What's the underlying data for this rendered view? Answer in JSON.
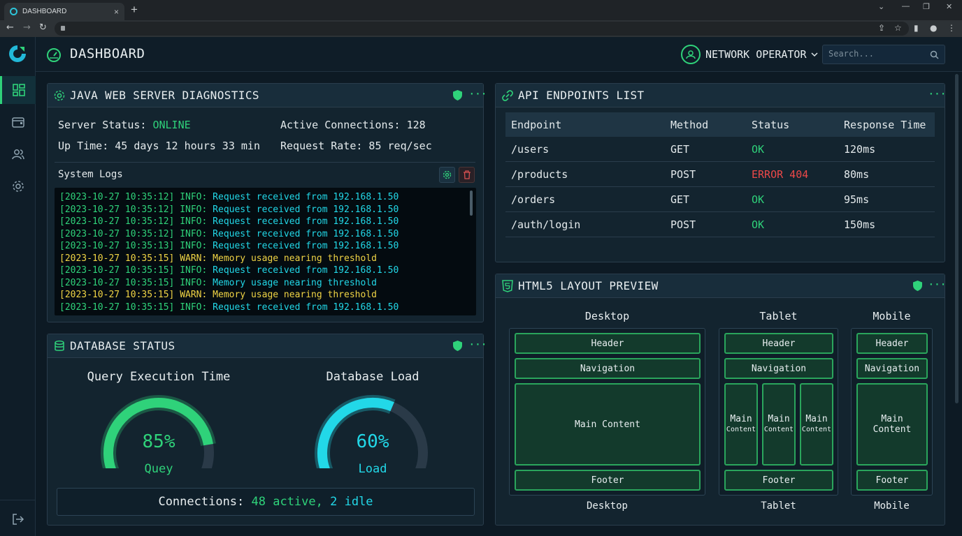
{
  "browser": {
    "tab_title": "DASHBOARD",
    "tab_close": "×",
    "new_tab": "+",
    "minimize": "⌄",
    "restore": "—",
    "maximize": "❐",
    "close": "✕"
  },
  "sidebar": {
    "items": [
      {
        "name": "dashboard",
        "icon": "grid-icon",
        "active": true
      },
      {
        "name": "wallet",
        "icon": "wallet-icon",
        "active": false
      },
      {
        "name": "users",
        "icon": "users-icon",
        "active": false
      },
      {
        "name": "settings",
        "icon": "gear-icon",
        "active": false
      }
    ],
    "logout_icon": "logout-icon"
  },
  "header": {
    "title": "DASHBOARD",
    "user_name": "NETWORK OPERATOR",
    "search_placeholder": "Search..."
  },
  "java_panel": {
    "title": "JAVA WEB SERVER DIAGNOSTICS",
    "server_status_label": "Server Status: ",
    "server_status_value": "ONLINE",
    "uptime": "Up Time: 45 days 12 hours 33 min",
    "active_connections": "Active Connections: 128",
    "request_rate": "Request Rate: 85 req/sec",
    "logs_label": "System Logs",
    "logs": [
      {
        "ts": "[2023-10-27 10:35:12]",
        "level": "INFO:",
        "msg": "Request received from 192.168.1.50",
        "type": "info"
      },
      {
        "ts": "[2023-10-27 10:35:12]",
        "level": "INFO:",
        "msg": "Request received from 192.168.1.50",
        "type": "info"
      },
      {
        "ts": "[2023-10-27 10:35:12]",
        "level": "INFO:",
        "msg": "Request received from 192.168.1.50",
        "type": "info"
      },
      {
        "ts": "[2023-10-27 10:35:12]",
        "level": "INFO:",
        "msg": "Request received from 192.168.1.50",
        "type": "info"
      },
      {
        "ts": "[2023-10-27 10:35:13]",
        "level": "INFO:",
        "msg": "Request received from 192.168.1.50",
        "type": "info"
      },
      {
        "ts": "[2023-10-27 10:35:15]",
        "level": "WARN:",
        "msg": "Memory usage nearing threshold",
        "type": "warn"
      },
      {
        "ts": "[2023-10-27 10:35:15]",
        "level": "INFO:",
        "msg": "Request received from 192.168.1.50",
        "type": "info"
      },
      {
        "ts": "[2023-10-27 10:35:15]",
        "level": "INFO:",
        "msg": "Memory usage nearing threshold",
        "type": "info"
      },
      {
        "ts": "[2023-10-27 10:35:15]",
        "level": "WARN:",
        "msg": "Memory usage nearing threshold",
        "type": "warn"
      },
      {
        "ts": "[2023-10-27 10:35:15]",
        "level": "INFO:",
        "msg": "Request received from 192.168.1.50",
        "type": "info"
      }
    ]
  },
  "db_panel": {
    "title": "DATABASE STATUS",
    "gauges": [
      {
        "label": "Query Execution Time",
        "value": "85%",
        "fraction": 0.85,
        "sub": "Quey",
        "color": "#2fd27a"
      },
      {
        "label": "Database Load",
        "value": "60%",
        "fraction": 0.6,
        "sub": "Load",
        "color": "#22d8e8"
      }
    ],
    "connections_label": "Connections: ",
    "connections_active": "48 active,",
    "connections_idle": "2 idle"
  },
  "api_panel": {
    "title": "API ENDPOINTS LIST",
    "columns": [
      "Endpoint",
      "Method",
      "Status",
      "Response Time"
    ],
    "rows": [
      {
        "endpoint": "/users",
        "method": "GET",
        "status": "OK",
        "ok": true,
        "time": "120ms"
      },
      {
        "endpoint": "/products",
        "method": "POST",
        "status": "ERROR 404",
        "ok": false,
        "time": "80ms"
      },
      {
        "endpoint": "/orders",
        "method": "GET",
        "status": "OK",
        "ok": true,
        "time": "95ms"
      },
      {
        "endpoint": "/auth/login",
        "method": "POST",
        "status": "OK",
        "ok": true,
        "time": "150ms"
      }
    ]
  },
  "html5_panel": {
    "title": "HTML5 LAYOUT PREVIEW",
    "desktop": {
      "title": "Desktop",
      "header": "Header",
      "nav": "Navigation",
      "main": "Main Content",
      "footer": "Footer",
      "caption": "Desktop"
    },
    "tablet": {
      "title": "Tablet",
      "header": "Header",
      "nav": "Navigation",
      "main_top": "Main",
      "main_bottom": "Content",
      "footer": "Footer",
      "caption": "Tablet"
    },
    "mobile": {
      "title": "Mobile",
      "header": "Header",
      "nav": "Navigation",
      "main_top": "Main",
      "main_bottom": "Content",
      "footer": "Footer",
      "caption": "Mobile"
    }
  },
  "colors": {
    "accent": "#2fd27a",
    "cyan": "#22d8e8",
    "warn": "#f0d445",
    "error": "#ec4848",
    "bg": "#0d1a24"
  }
}
